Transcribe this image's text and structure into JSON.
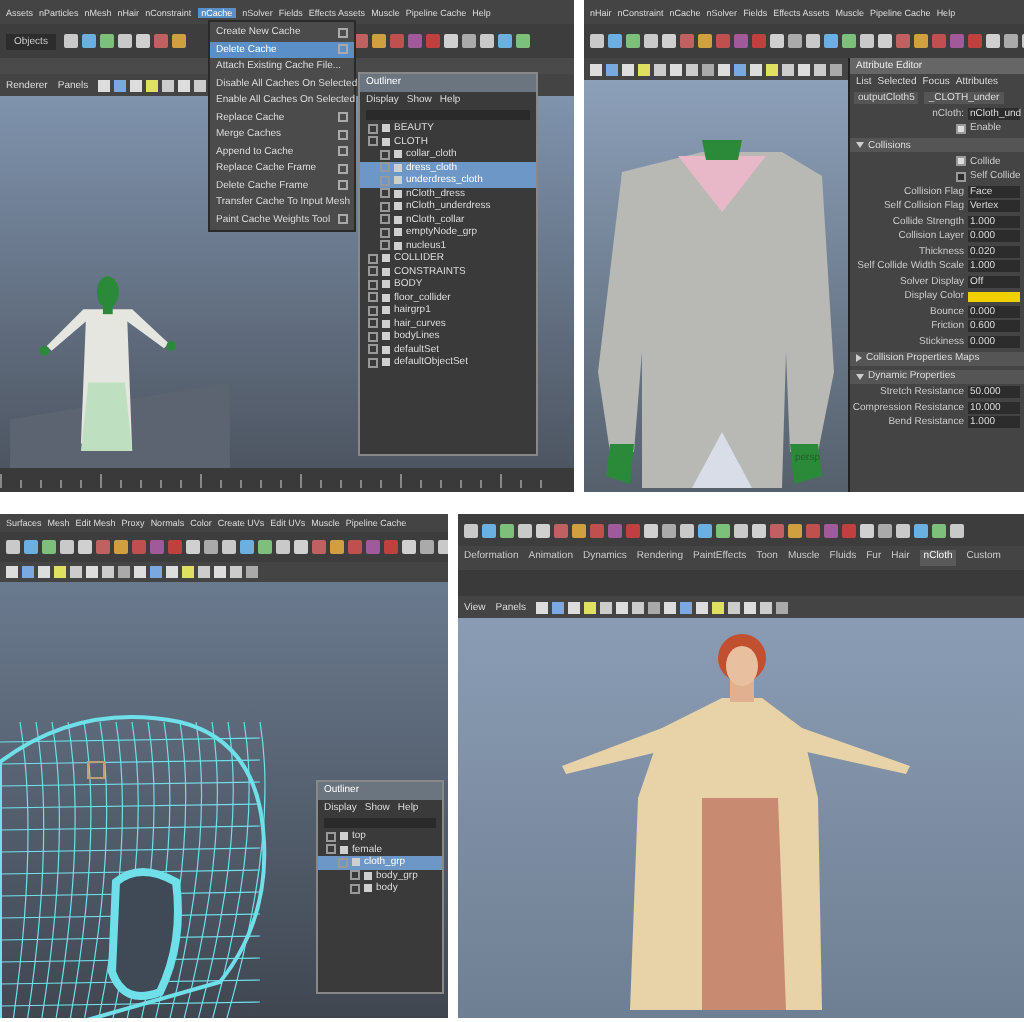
{
  "top_left": {
    "menubar": [
      {
        "label": "Assets",
        "selected": false
      },
      {
        "label": "nParticles",
        "selected": false
      },
      {
        "label": "nMesh",
        "selected": false
      },
      {
        "label": "nHair",
        "selected": false
      },
      {
        "label": "nConstraint",
        "selected": false
      },
      {
        "label": "nCache",
        "selected": true
      },
      {
        "label": "nSolver",
        "selected": false
      },
      {
        "label": "Fields",
        "selected": false
      },
      {
        "label": "Effects Assets",
        "selected": false
      },
      {
        "label": "Muscle",
        "selected": false
      },
      {
        "label": "Pipeline Cache",
        "selected": false
      },
      {
        "label": "Help",
        "selected": false
      }
    ],
    "field": "Objects",
    "panel_menu": [
      "Renderer",
      "Panels"
    ],
    "menu": [
      {
        "label": "Create New Cache",
        "selected": false,
        "option_box": true
      },
      {
        "label": "Delete Cache",
        "selected": true,
        "option_box": true
      },
      {
        "label": "Attach Existing Cache File...",
        "selected": false,
        "option_box": false
      },
      {
        "label": "Disable All Caches On Selected",
        "selected": false,
        "option_box": false
      },
      {
        "label": "Enable All Caches On Selected",
        "selected": false,
        "option_box": false
      },
      {
        "label": "Replace Cache",
        "selected": false,
        "option_box": true
      },
      {
        "label": "Merge Caches",
        "selected": false,
        "option_box": true
      },
      {
        "label": "Append to Cache",
        "selected": false,
        "option_box": true
      },
      {
        "label": "Replace Cache Frame",
        "selected": false,
        "option_box": true
      },
      {
        "label": "Delete Cache Frame",
        "selected": false,
        "option_box": true
      },
      {
        "label": "Transfer Cache To Input Mesh",
        "selected": false,
        "option_box": false
      },
      {
        "label": "Paint Cache Weights Tool",
        "selected": false,
        "option_box": true
      }
    ],
    "outliner": {
      "title": "Outliner",
      "menu": [
        "Display",
        "Show",
        "Help"
      ],
      "items": [
        {
          "label": "BEAUTY",
          "selected": false
        },
        {
          "label": "CLOTH",
          "selected": false,
          "children": [
            {
              "label": "collar_cloth",
              "selected": false
            },
            {
              "label": "dress_cloth",
              "selected": true
            },
            {
              "label": "underdress_cloth",
              "selected": true
            },
            {
              "label": "nCloth_dress",
              "selected": false
            },
            {
              "label": "nCloth_underdress",
              "selected": false
            },
            {
              "label": "nCloth_collar",
              "selected": false
            },
            {
              "label": "emptyNode_grp",
              "selected": false
            },
            {
              "label": "nucleus1",
              "selected": false
            }
          ]
        },
        {
          "label": "COLLIDER",
          "selected": false
        },
        {
          "label": "CONSTRAINTS",
          "selected": false
        },
        {
          "label": "BODY",
          "selected": false
        },
        {
          "label": "floor_collider",
          "selected": false
        },
        {
          "label": "hairgrp1",
          "selected": false
        },
        {
          "label": "hair_curves",
          "selected": false
        },
        {
          "label": "bodyLines",
          "selected": false
        },
        {
          "label": "defaultSet",
          "selected": false
        },
        {
          "label": "defaultObjectSet",
          "selected": false
        }
      ]
    }
  },
  "top_right": {
    "menubar": [
      "nHair",
      "nConstraint",
      "nCache",
      "nSolver",
      "Fields",
      "Effects Assets",
      "Muscle",
      "Pipeline Cache",
      "Help"
    ],
    "camera": "persp",
    "editor": {
      "title": "Attribute Editor",
      "menu": [
        "List",
        "Selected",
        "Focus",
        "Attributes"
      ],
      "node": "outputCloth5",
      "tab": "_CLOTH_under",
      "shape_label": "nCloth:",
      "shape": "nCloth_und",
      "rows": [
        {
          "kind": "check",
          "label": "Enable",
          "checked": true
        },
        {
          "kind": "header",
          "label": "Collisions",
          "expanded": true
        },
        {
          "kind": "check",
          "label": "Collide",
          "checked": true
        },
        {
          "kind": "check",
          "label": "Self Collide",
          "checked": false
        },
        {
          "kind": "value",
          "label": "Collision Flag",
          "value": "Face"
        },
        {
          "kind": "value",
          "label": "Self Collision Flag",
          "value": "Vertex"
        },
        {
          "kind": "value",
          "label": "Collide Strength",
          "value": "1.000"
        },
        {
          "kind": "value",
          "label": "Collision Layer",
          "value": "0.000"
        },
        {
          "kind": "value",
          "label": "Thickness",
          "value": "0.020"
        },
        {
          "kind": "value",
          "label": "Self Collide Width Scale",
          "value": "1.000"
        },
        {
          "kind": "value",
          "label": "Solver Display",
          "value": "Off"
        },
        {
          "kind": "color",
          "label": "Display Color",
          "color": "#f0d000"
        },
        {
          "kind": "value",
          "label": "Bounce",
          "value": "0.000"
        },
        {
          "kind": "value",
          "label": "Friction",
          "value": "0.600"
        },
        {
          "kind": "value",
          "label": "Stickiness",
          "value": "0.000"
        },
        {
          "kind": "header",
          "label": "Collision Properties Maps",
          "expanded": false
        },
        {
          "kind": "header",
          "label": "Dynamic Properties",
          "expanded": true
        },
        {
          "kind": "value",
          "label": "Stretch Resistance",
          "value": "50.000"
        },
        {
          "kind": "value",
          "label": "Compression Resistance",
          "value": "10.000"
        },
        {
          "kind": "value",
          "label": "Bend Resistance",
          "value": "1.000"
        }
      ]
    }
  },
  "bottom_left": {
    "menubar": [
      "Surfaces",
      "Mesh",
      "Edit Mesh",
      "Proxy",
      "Normals",
      "Color",
      "Create UVs",
      "Edit UVs",
      "Muscle",
      "Pipeline Cache"
    ],
    "outliner": {
      "title": "Outliner",
      "menu": [
        "Display",
        "Show",
        "Help"
      ],
      "items": [
        {
          "label": "top",
          "selected": false
        },
        {
          "label": "female",
          "selected": false,
          "children": [
            {
              "label": "cloth_grp",
              "selected": true,
              "children": [
                {
                  "label": "body_grp",
                  "selected": false
                },
                {
                  "label": "body",
                  "selected": false
                }
              ]
            }
          ]
        }
      ]
    }
  },
  "bottom_right": {
    "shelf_tabs": [
      {
        "label": "Deformation",
        "selected": false
      },
      {
        "label": "Animation",
        "selected": false
      },
      {
        "label": "Dynamics",
        "selected": false
      },
      {
        "label": "Rendering",
        "selected": false
      },
      {
        "label": "PaintEffects",
        "selected": false
      },
      {
        "label": "Toon",
        "selected": false
      },
      {
        "label": "Muscle",
        "selected": false
      },
      {
        "label": "Fluids",
        "selected": false
      },
      {
        "label": "Fur",
        "selected": false
      },
      {
        "label": "Hair",
        "selected": false
      },
      {
        "label": "nCloth",
        "selected": true
      },
      {
        "label": "Custom",
        "selected": false
      }
    ],
    "panel_menu": [
      "View",
      "Panels"
    ]
  }
}
